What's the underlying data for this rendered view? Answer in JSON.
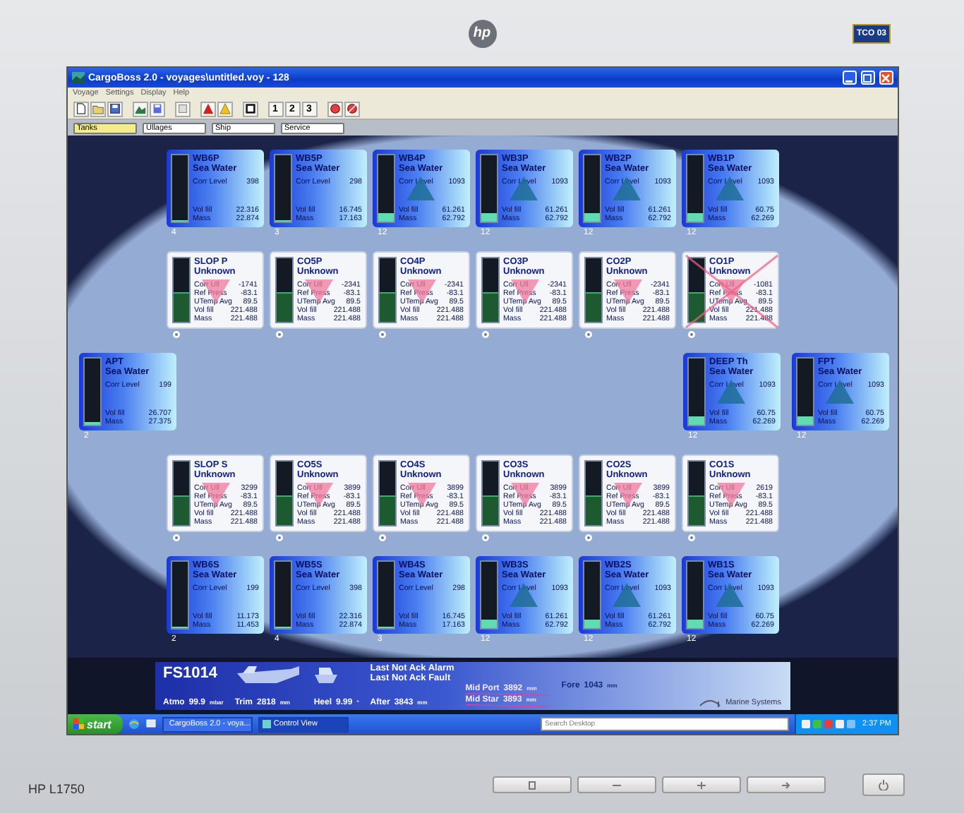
{
  "monitor": {
    "logo": "hp",
    "badge": "TCO 03",
    "model": "HP L1750"
  },
  "window": {
    "title": "CargoBoss 2.0 - voyages\\untitled.voy - 128"
  },
  "menu": [
    "Voyage",
    "Settings",
    "Display",
    "Help"
  ],
  "toolbar": {
    "numbers": [
      "1",
      "2",
      "3"
    ]
  },
  "tabs": [
    {
      "label": "Tanks",
      "selected": true
    },
    {
      "label": "Ullages",
      "selected": false
    },
    {
      "label": "Ship",
      "selected": false
    },
    {
      "label": "Service",
      "selected": false
    }
  ],
  "tank_rows": [
    {
      "kind": "full",
      "tanks": [
        {
          "kind": "ballast",
          "name": "WB6P",
          "content": "Sea Water",
          "level": 0.03,
          "alarm": false,
          "crossed": false,
          "tag": "4",
          "readings": [
            {
              "label": "Corr Level",
              "value": "398"
            },
            {
              "label": "Vol fill",
              "value": "22.316"
            },
            {
              "label": "Mass",
              "value": "22.874"
            }
          ]
        },
        {
          "kind": "ballast",
          "name": "WB5P",
          "content": "Sea Water",
          "level": 0.02,
          "alarm": false,
          "crossed": false,
          "tag": "3",
          "readings": [
            {
              "label": "Corr Level",
              "value": "298"
            },
            {
              "label": "Vol fill",
              "value": "16.745"
            },
            {
              "label": "Mass",
              "value": "17.163"
            }
          ]
        },
        {
          "kind": "ballast",
          "name": "WB4P",
          "content": "Sea Water",
          "level": 0.12,
          "alarm": true,
          "crossed": false,
          "tag": "12",
          "readings": [
            {
              "label": "Corr Level",
              "value": "1093"
            },
            {
              "label": "Vol fill",
              "value": "61.261"
            },
            {
              "label": "Mass",
              "value": "62.792"
            }
          ]
        },
        {
          "kind": "ballast",
          "name": "WB3P",
          "content": "Sea Water",
          "level": 0.12,
          "alarm": true,
          "crossed": false,
          "tag": "12",
          "readings": [
            {
              "label": "Corr Level",
              "value": "1093"
            },
            {
              "label": "Vol fill",
              "value": "61.261"
            },
            {
              "label": "Mass",
              "value": "62.792"
            }
          ]
        },
        {
          "kind": "ballast",
          "name": "WB2P",
          "content": "Sea Water",
          "level": 0.12,
          "alarm": true,
          "crossed": false,
          "tag": "12",
          "readings": [
            {
              "label": "Corr Level",
              "value": "1093"
            },
            {
              "label": "Vol fill",
              "value": "61.261"
            },
            {
              "label": "Mass",
              "value": "62.792"
            }
          ]
        },
        {
          "kind": "ballast",
          "name": "WB1P",
          "content": "Sea Water",
          "level": 0.12,
          "alarm": true,
          "crossed": false,
          "tag": "12",
          "readings": [
            {
              "label": "Corr Level",
              "value": "1093"
            },
            {
              "label": "Vol fill",
              "value": "60.75"
            },
            {
              "label": "Mass",
              "value": "62.269"
            }
          ]
        }
      ]
    },
    {
      "kind": "full",
      "tanks": [
        {
          "kind": "cargo",
          "name": "SLOP P",
          "content": "Unknown",
          "level": 0.45,
          "alarm": true,
          "crossed": false,
          "readings": [
            {
              "label": "Corr Ull",
              "value": "-1741"
            },
            {
              "label": "Ref Press",
              "value": "-83.1"
            },
            {
              "label": "UTemp Avg",
              "value": "89.5"
            },
            {
              "label": "Vol fill",
              "value": "221.488"
            },
            {
              "label": "Mass",
              "value": "221.488"
            }
          ]
        },
        {
          "kind": "cargo",
          "name": "CO5P",
          "content": "Unknown",
          "level": 0.45,
          "alarm": true,
          "crossed": false,
          "readings": [
            {
              "label": "Corr Ull",
              "value": "-2341"
            },
            {
              "label": "Ref Press",
              "value": "-83.1"
            },
            {
              "label": "UTemp Avg",
              "value": "89.5"
            },
            {
              "label": "Vol fill",
              "value": "221.488"
            },
            {
              "label": "Mass",
              "value": "221.488"
            }
          ]
        },
        {
          "kind": "cargo",
          "name": "CO4P",
          "content": "Unknown",
          "level": 0.45,
          "alarm": true,
          "crossed": false,
          "readings": [
            {
              "label": "Corr Ull",
              "value": "-2341"
            },
            {
              "label": "Ref Press",
              "value": "-83.1"
            },
            {
              "label": "UTemp Avg",
              "value": "89.5"
            },
            {
              "label": "Vol fill",
              "value": "221.488"
            },
            {
              "label": "Mass",
              "value": "221.488"
            }
          ]
        },
        {
          "kind": "cargo",
          "name": "CO3P",
          "content": "Unknown",
          "level": 0.45,
          "alarm": true,
          "crossed": false,
          "readings": [
            {
              "label": "Corr Ull",
              "value": "-2341"
            },
            {
              "label": "Ref Press",
              "value": "-83.1"
            },
            {
              "label": "UTemp Avg",
              "value": "89.5"
            },
            {
              "label": "Vol fill",
              "value": "221.488"
            },
            {
              "label": "Mass",
              "value": "221.488"
            }
          ]
        },
        {
          "kind": "cargo",
          "name": "CO2P",
          "content": "Unknown",
          "level": 0.45,
          "alarm": true,
          "crossed": false,
          "readings": [
            {
              "label": "Corr Ull",
              "value": "-2341"
            },
            {
              "label": "Ref Press",
              "value": "-83.1"
            },
            {
              "label": "UTemp Avg",
              "value": "89.5"
            },
            {
              "label": "Vol fill",
              "value": "221.488"
            },
            {
              "label": "Mass",
              "value": "221.488"
            }
          ]
        },
        {
          "kind": "cargo",
          "name": "CO1P",
          "content": "Unknown",
          "level": 0.45,
          "alarm": true,
          "crossed": true,
          "readings": [
            {
              "label": "Corr Ull",
              "value": "-1081"
            },
            {
              "label": "Ref Press",
              "value": "-83.1"
            },
            {
              "label": "UTemp Avg",
              "value": "89.5"
            },
            {
              "label": "Vol fill",
              "value": "221.488"
            },
            {
              "label": "Mass",
              "value": "221.488"
            }
          ]
        }
      ]
    },
    {
      "kind": "ends",
      "aft": [
        {
          "kind": "ballast",
          "name": "APT",
          "content": "Sea Water",
          "level": 0.04,
          "alarm": false,
          "crossed": false,
          "tag": "2",
          "readings": [
            {
              "label": "Corr Level",
              "value": "199"
            },
            {
              "label": "Vol fill",
              "value": "26.707"
            },
            {
              "label": "Mass",
              "value": "27.375"
            }
          ]
        }
      ],
      "fore": [
        {
          "kind": "ballast",
          "name": "DEEP Th",
          "content": "Sea Water",
          "level": 0.12,
          "alarm": true,
          "crossed": false,
          "tag": "12",
          "readings": [
            {
              "label": "Corr Level",
              "value": "1093"
            },
            {
              "label": "Vol fill",
              "value": "60.75"
            },
            {
              "label": "Mass",
              "value": "62.269"
            }
          ]
        },
        {
          "kind": "ballast",
          "name": "FPT",
          "content": "Sea Water",
          "level": 0.12,
          "alarm": true,
          "crossed": false,
          "tag": "12",
          "readings": [
            {
              "label": "Corr Level",
              "value": "1093"
            },
            {
              "label": "Vol fill",
              "value": "60.75"
            },
            {
              "label": "Mass",
              "value": "62.269"
            }
          ]
        }
      ]
    },
    {
      "kind": "full",
      "tanks": [
        {
          "kind": "cargo",
          "name": "SLOP S",
          "content": "Unknown",
          "level": 0.45,
          "alarm": true,
          "crossed": false,
          "readings": [
            {
              "label": "Corr Ull",
              "value": "3299"
            },
            {
              "label": "Ref Press",
              "value": "-83.1"
            },
            {
              "label": "UTemp Avg",
              "value": "89.5"
            },
            {
              "label": "Vol fill",
              "value": "221.488"
            },
            {
              "label": "Mass",
              "value": "221.488"
            }
          ]
        },
        {
          "kind": "cargo",
          "name": "CO5S",
          "content": "Unknown",
          "level": 0.45,
          "alarm": true,
          "crossed": false,
          "readings": [
            {
              "label": "Corr Ull",
              "value": "3899"
            },
            {
              "label": "Ref Press",
              "value": "-83.1"
            },
            {
              "label": "UTemp Avg",
              "value": "89.5"
            },
            {
              "label": "Vol fill",
              "value": "221.488"
            },
            {
              "label": "Mass",
              "value": "221.488"
            }
          ]
        },
        {
          "kind": "cargo",
          "name": "CO4S",
          "content": "Unknown",
          "level": 0.45,
          "alarm": true,
          "crossed": false,
          "readings": [
            {
              "label": "Corr Ull",
              "value": "3899"
            },
            {
              "label": "Ref Press",
              "value": "-83.1"
            },
            {
              "label": "UTemp Avg",
              "value": "89.5"
            },
            {
              "label": "Vol fill",
              "value": "221.488"
            },
            {
              "label": "Mass",
              "value": "221.488"
            }
          ]
        },
        {
          "kind": "cargo",
          "name": "CO3S",
          "content": "Unknown",
          "level": 0.45,
          "alarm": true,
          "crossed": false,
          "readings": [
            {
              "label": "Corr Ull",
              "value": "3899"
            },
            {
              "label": "Ref Press",
              "value": "-83.1"
            },
            {
              "label": "UTemp Avg",
              "value": "89.5"
            },
            {
              "label": "Vol fill",
              "value": "221.488"
            },
            {
              "label": "Mass",
              "value": "221.488"
            }
          ]
        },
        {
          "kind": "cargo",
          "name": "CO2S",
          "content": "Unknown",
          "level": 0.45,
          "alarm": true,
          "crossed": false,
          "readings": [
            {
              "label": "Corr Ull",
              "value": "3899"
            },
            {
              "label": "Ref Press",
              "value": "-83.1"
            },
            {
              "label": "UTemp Avg",
              "value": "89.5"
            },
            {
              "label": "Vol fill",
              "value": "221.488"
            },
            {
              "label": "Mass",
              "value": "221.488"
            }
          ]
        },
        {
          "kind": "cargo",
          "name": "CO1S",
          "content": "Unknown",
          "level": 0.45,
          "alarm": true,
          "crossed": false,
          "readings": [
            {
              "label": "Corr Ull",
              "value": "2619"
            },
            {
              "label": "Ref Press",
              "value": "-83.1"
            },
            {
              "label": "UTemp Avg",
              "value": "89.5"
            },
            {
              "label": "Vol fill",
              "value": "221.488"
            },
            {
              "label": "Mass",
              "value": "221.488"
            }
          ]
        }
      ]
    },
    {
      "kind": "full",
      "tanks": [
        {
          "kind": "ballast",
          "name": "WB6S",
          "content": "Sea Water",
          "level": 0.02,
          "alarm": false,
          "crossed": false,
          "tag": "2",
          "readings": [
            {
              "label": "Corr Level",
              "value": "199"
            },
            {
              "label": "Vol fill",
              "value": "11.173"
            },
            {
              "label": "Mass",
              "value": "11.453"
            }
          ]
        },
        {
          "kind": "ballast",
          "name": "WB5S",
          "content": "Sea Water",
          "level": 0.03,
          "alarm": false,
          "crossed": false,
          "tag": "4",
          "readings": [
            {
              "label": "Corr Level",
              "value": "398"
            },
            {
              "label": "Vol fill",
              "value": "22.316"
            },
            {
              "label": "Mass",
              "value": "22.874"
            }
          ]
        },
        {
          "kind": "ballast",
          "name": "WB4S",
          "content": "Sea Water",
          "level": 0.02,
          "alarm": false,
          "crossed": false,
          "tag": "3",
          "readings": [
            {
              "label": "Corr Level",
              "value": "298"
            },
            {
              "label": "Vol fill",
              "value": "16.745"
            },
            {
              "label": "Mass",
              "value": "17.163"
            }
          ]
        },
        {
          "kind": "ballast",
          "name": "WB3S",
          "content": "Sea Water",
          "level": 0.12,
          "alarm": true,
          "crossed": false,
          "tag": "12",
          "readings": [
            {
              "label": "Corr Level",
              "value": "1093"
            },
            {
              "label": "Vol fill",
              "value": "61.261"
            },
            {
              "label": "Mass",
              "value": "62.792"
            }
          ]
        },
        {
          "kind": "ballast",
          "name": "WB2S",
          "content": "Sea Water",
          "level": 0.12,
          "alarm": true,
          "crossed": false,
          "tag": "12",
          "readings": [
            {
              "label": "Corr Level",
              "value": "1093"
            },
            {
              "label": "Vol fill",
              "value": "61.261"
            },
            {
              "label": "Mass",
              "value": "62.792"
            }
          ]
        },
        {
          "kind": "ballast",
          "name": "WB1S",
          "content": "Sea Water",
          "level": 0.12,
          "alarm": true,
          "crossed": false,
          "tag": "12",
          "readings": [
            {
              "label": "Corr Level",
              "value": "1093"
            },
            {
              "label": "Vol fill",
              "value": "60.75"
            },
            {
              "label": "Mass",
              "value": "62.269"
            }
          ]
        }
      ]
    }
  ],
  "status": {
    "id": "FS1014",
    "atmo": {
      "label": "Atmo",
      "value": "99.9",
      "unit": "mbar"
    },
    "trim": {
      "label": "Trim",
      "value": "2818",
      "unit": "mm"
    },
    "heel": {
      "label": "Heel",
      "value": "9.99",
      "unit": "°"
    },
    "alarms": [
      "Last Not Ack Alarm",
      "Last Not Ack Fault"
    ],
    "after": {
      "label": "After",
      "value": "3843",
      "unit": "mm"
    },
    "mid": [
      {
        "label": "Mid Port",
        "value": "3892",
        "unit": "mm",
        "crossed": true
      },
      {
        "label": "Mid Star",
        "value": "3893",
        "unit": "mm",
        "crossed": true
      }
    ],
    "fore": {
      "label": "Fore",
      "value": "1043",
      "unit": "mm",
      "disabled": true
    },
    "brand": "Marine Systems"
  },
  "taskbar": {
    "start": "start",
    "tasks": [
      {
        "label": "CargoBoss 2.0 - voya...",
        "selected": false
      },
      {
        "label": "Control View",
        "selected": true
      }
    ],
    "search": {
      "placeholder": "Search Desktop"
    },
    "clock": "2:37 PM"
  }
}
